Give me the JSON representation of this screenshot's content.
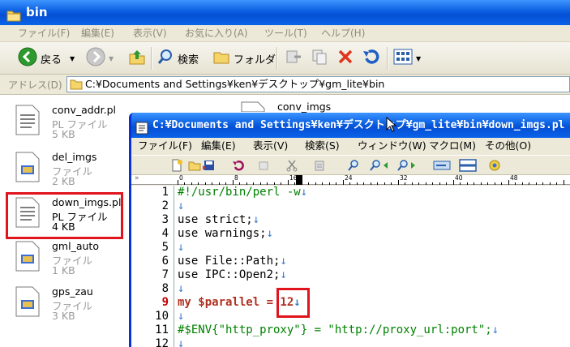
{
  "explorer": {
    "title": "bin",
    "menu": [
      "ファイル(F)",
      "編集(E)",
      "表示(V)",
      "お気に入り(A)",
      "ツール(T)",
      "ヘルプ(H)"
    ],
    "toolbar": {
      "back": "戻る",
      "search": "検索",
      "folders": "フォルダ"
    },
    "address_label": "アドレス(D)",
    "address": "C:¥Documents and Settings¥ken¥デスクトップ¥gm_lite¥bin",
    "files": [
      {
        "name": "conv_addr.pl",
        "type": "PL ファイル",
        "size": "5 KB"
      },
      {
        "name": "del_imgs",
        "type": "ファイル",
        "size": "2 KB"
      },
      {
        "name": "down_imgs.pl",
        "type": "PL ファイル",
        "size": "4 KB"
      },
      {
        "name": "gml_auto",
        "type": "ファイル",
        "size": "1 KB"
      },
      {
        "name": "gps_zau",
        "type": "ファイル",
        "size": "3 KB"
      },
      {
        "name": "conv_imgs",
        "type": "",
        "size": ""
      }
    ]
  },
  "editor": {
    "title": "C:¥Documents and Settings¥ken¥デスクトップ¥gm_lite¥bin¥down_imgs.pl",
    "menu": [
      "ファイル(F)",
      "編集(E)",
      "表示(V)",
      "検索(S)",
      "ウィンドウ(W)",
      "マクロ(M)",
      "その他(O)"
    ],
    "ruler": {
      "marker": "»",
      "ticks": [
        "0",
        "8",
        "16",
        "24",
        "32",
        "40",
        "48"
      ]
    },
    "current_line": 9,
    "lines": [
      {
        "n": "1",
        "text": "#!/usr/bin/perl -w",
        "eol": "↓"
      },
      {
        "n": "2",
        "text": "",
        "eol": "↓"
      },
      {
        "n": "3",
        "text": "use strict;",
        "eol": "↓"
      },
      {
        "n": "4",
        "text": "use warnings;",
        "eol": "↓"
      },
      {
        "n": "5",
        "text": "",
        "eol": "↓"
      },
      {
        "n": "6",
        "text": "use File::Path;",
        "eol": "↓"
      },
      {
        "n": "7",
        "text": "use IPC::Open2;",
        "eol": "↓"
      },
      {
        "n": "8",
        "text": "",
        "eol": "↓"
      },
      {
        "n": "9",
        "text": "my $parallel = 12",
        "eol": "↓"
      },
      {
        "n": "10",
        "text": "",
        "eol": "↓"
      },
      {
        "n": "11",
        "text": "#$ENV{\"http_proxy\"} = \"http://proxy_url:port\";",
        "eol": "↓"
      },
      {
        "n": "12",
        "text": "",
        "eol": "↓"
      }
    ]
  },
  "colors": {
    "titlebar": "#0a5ee0",
    "highlight": "#e0141c",
    "comment": "#008000",
    "keyword": "#000080"
  }
}
